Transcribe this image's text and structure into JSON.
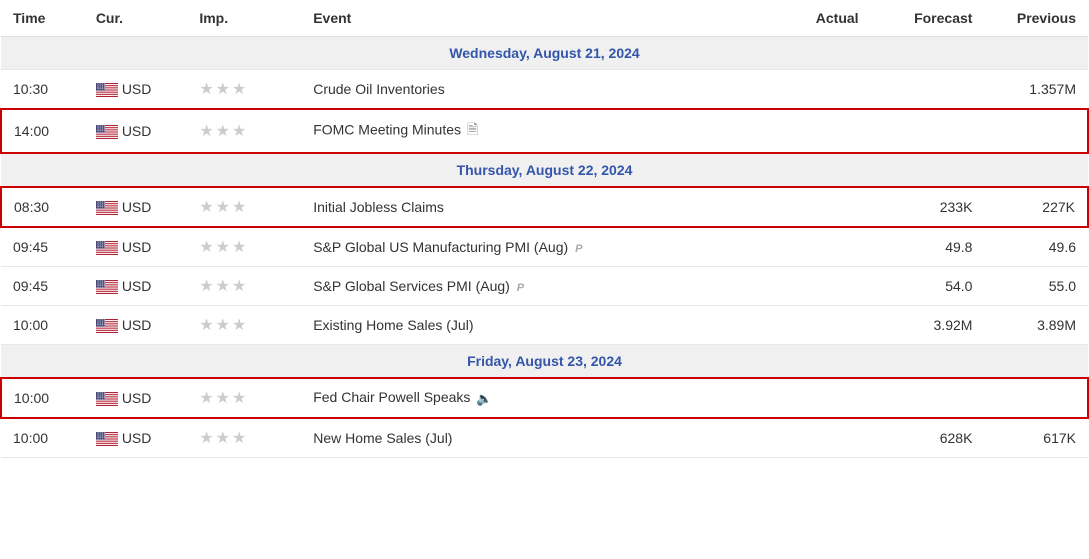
{
  "table": {
    "columns": [
      "Time",
      "Cur.",
      "Imp.",
      "Event",
      "Actual",
      "Forecast",
      "Previous"
    ],
    "sections": [
      {
        "date": "Wednesday, August 21, 2024",
        "rows": [
          {
            "time": "10:30",
            "currency": "USD",
            "importance": 3,
            "event": "Crude Oil Inventories",
            "actual": "",
            "forecast": "",
            "previous": "1.357M",
            "highlighted": false,
            "event_suffix": null
          },
          {
            "time": "14:00",
            "currency": "USD",
            "importance": 3,
            "event": "FOMC Meeting Minutes",
            "actual": "",
            "forecast": "",
            "previous": "",
            "highlighted": true,
            "event_suffix": "doc"
          }
        ]
      },
      {
        "date": "Thursday, August 22, 2024",
        "rows": [
          {
            "time": "08:30",
            "currency": "USD",
            "importance": 3,
            "event": "Initial Jobless Claims",
            "actual": "",
            "forecast": "233K",
            "previous": "227K",
            "highlighted": true,
            "event_suffix": null
          },
          {
            "time": "09:45",
            "currency": "USD",
            "importance": 3,
            "event": "S&P Global US Manufacturing PMI (Aug)",
            "actual": "",
            "forecast": "49.8",
            "previous": "49.6",
            "highlighted": false,
            "event_suffix": "p"
          },
          {
            "time": "09:45",
            "currency": "USD",
            "importance": 3,
            "event": "S&P Global Services PMI (Aug)",
            "actual": "",
            "forecast": "54.0",
            "previous": "55.0",
            "highlighted": false,
            "event_suffix": "p"
          },
          {
            "time": "10:00",
            "currency": "USD",
            "importance": 3,
            "event": "Existing Home Sales (Jul)",
            "actual": "",
            "forecast": "3.92M",
            "previous": "3.89M",
            "highlighted": false,
            "event_suffix": null
          }
        ]
      },
      {
        "date": "Friday, August 23, 2024",
        "rows": [
          {
            "time": "10:00",
            "currency": "USD",
            "importance": 3,
            "event": "Fed Chair Powell Speaks",
            "actual": "",
            "forecast": "",
            "previous": "",
            "highlighted": true,
            "event_suffix": "speaker"
          },
          {
            "time": "10:00",
            "currency": "USD",
            "importance": 3,
            "event": "New Home Sales (Jul)",
            "actual": "",
            "forecast": "628K",
            "previous": "617K",
            "highlighted": false,
            "event_suffix": null
          }
        ]
      }
    ]
  }
}
